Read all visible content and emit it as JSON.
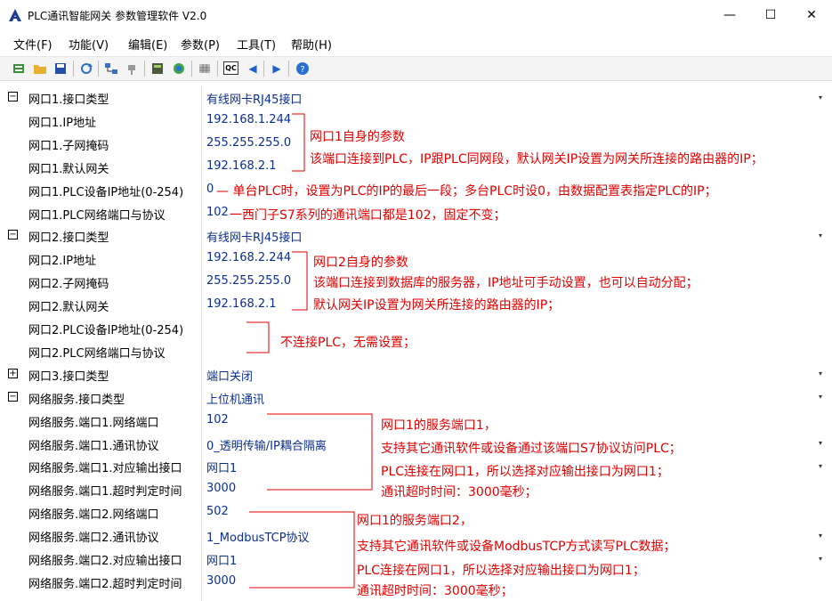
{
  "window": {
    "title": "PLC通讯智能网关 参数管理软件 V2.0",
    "minimize_glyph": "—",
    "maximize_glyph": "☐",
    "close_glyph": "✕"
  },
  "menu": {
    "items": [
      {
        "label": "文件(F)"
      },
      {
        "label": "功能(V)"
      },
      {
        "label": "编辑(E)"
      },
      {
        "label": "参数(P)"
      },
      {
        "label": "工具(T)"
      },
      {
        "label": "帮助(H)"
      }
    ]
  },
  "toolbar": {
    "icons": [
      "new-icon",
      "open-icon",
      "save-icon",
      "refresh-icon",
      "network-icon",
      "plug-icon",
      "device-icon",
      "globe-icon",
      "grid-icon",
      "qc-icon",
      "left-arrow-icon",
      "right-arrow-icon",
      "help-icon"
    ],
    "qc_label": "QC"
  },
  "properties": [
    {
      "name": "网口1.接口类型",
      "value": "有线网卡RJ45接口",
      "expander": "minus",
      "dropdown": true
    },
    {
      "name": "网口1.IP地址",
      "value": "192.168.1.244"
    },
    {
      "name": "网口1.子网掩码",
      "value": "255.255.255.0"
    },
    {
      "name": "网口1.默认网关",
      "value": "192.168.2.1"
    },
    {
      "name": "网口1.PLC设备IP地址(0-254)",
      "value": "0"
    },
    {
      "name": "网口1.PLC网络端口与协议",
      "value": "102"
    },
    {
      "name": "网口2.接口类型",
      "value": "有线网卡RJ45接口",
      "expander": "minus",
      "dropdown": true
    },
    {
      "name": "网口2.IP地址",
      "value": "192.168.2.244"
    },
    {
      "name": "网口2.子网掩码",
      "value": "255.255.255.0"
    },
    {
      "name": "网口2.默认网关",
      "value": "192.168.2.1"
    },
    {
      "name": "网口2.PLC设备IP地址(0-254)",
      "value": ""
    },
    {
      "name": "网口2.PLC网络端口与协议",
      "value": ""
    },
    {
      "name": "网口3.接口类型",
      "value": "端口关闭",
      "expander": "plus",
      "dropdown": true
    },
    {
      "name": "网络服务.接口类型",
      "value": "上位机通讯",
      "expander": "minus",
      "dropdown": true
    },
    {
      "name": "网络服务.端口1.网络端口",
      "value": "102"
    },
    {
      "name": "网络服务.端口1.通讯协议",
      "value": "0_透明传输/IP耦合隔离",
      "dropdown": true
    },
    {
      "name": "网络服务.端口1.对应输出接口",
      "value": "网口1",
      "dropdown": true
    },
    {
      "name": "网络服务.端口1.超时判定时间",
      "value": "3000"
    },
    {
      "name": "网络服务.端口2.网络端口",
      "value": "502"
    },
    {
      "name": "网络服务.端口2.通讯协议",
      "value": "1_ModbusTCP协议",
      "dropdown": true
    },
    {
      "name": "网络服务.端口2.对应输出接口",
      "value": "网口1",
      "dropdown": true
    },
    {
      "name": "网络服务.端口2.超时判定时间",
      "value": "3000"
    }
  ],
  "annotations": {
    "a1": "网口1自身的参数",
    "a2": "该端口连接到PLC，IP跟PLC同网段，默认网关IP设置为网关所连接的路由器的IP；",
    "a3": "— 单台PLC时，设置为PLC的IP的最后一段；多台PLC时设0，由数据配置表指定PLC的IP；",
    "a4": "一西门子S7系列的通讯端口都是102，固定不变；",
    "a5": "网口2自身的参数",
    "a6": "该端口连接到数据库的服务器，IP地址可手动设置，也可以自动分配；",
    "a7": "默认网关IP设置为网关所连接的路由器的IP；",
    "a8": "不连接PLC，无需设置；",
    "a9": "网口1的服务端口1，",
    "a10": "支持其它通讯软件或设备通过该端口S7协议访问PLC；",
    "a11": "PLC连接在网口1，所以选择对应输出接口为网口1；",
    "a12": "通讯超时时间：3000毫秒；",
    "a13": "网口1的服务端口2，",
    "a14": "支持其它通讯软件或设备ModbusTCP方式读写PLC数据；",
    "a15": "PLC连接在网口1，所以选择对应输出接口为网口1；",
    "a16": "通讯超时时间：3000毫秒；"
  },
  "colors": {
    "annotation": "#e00000",
    "value": "#0b2f8e"
  }
}
